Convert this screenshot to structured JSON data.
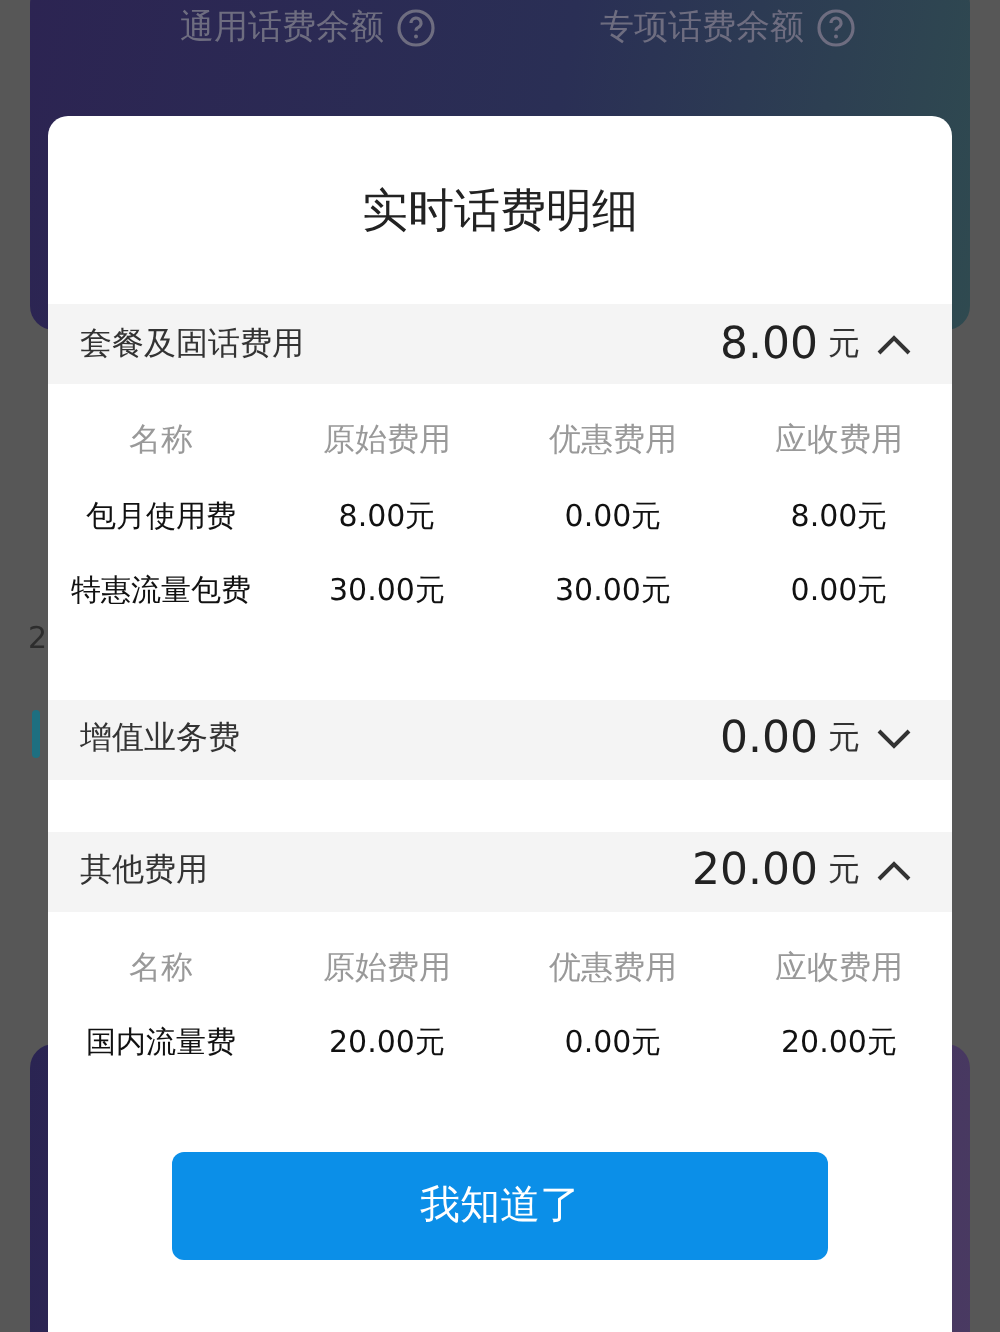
{
  "background": {
    "balances": [
      {
        "label": "通用话费余额"
      },
      {
        "label": "专项话费余额"
      }
    ],
    "side_text": "2"
  },
  "dialog": {
    "title": "实时话费明细",
    "sections": [
      {
        "name": "套餐及固话费用",
        "total": "8.00",
        "unit": "元",
        "expanded": true,
        "columns": [
          "名称",
          "原始费用",
          "优惠费用",
          "应收费用"
        ],
        "rows": [
          [
            "包月使用费",
            "8.00元",
            "0.00元",
            "8.00元"
          ],
          [
            "特惠流量包费",
            "30.00元",
            "30.00元",
            "0.00元"
          ]
        ]
      },
      {
        "name": "增值业务费",
        "total": "0.00",
        "unit": "元",
        "expanded": false
      },
      {
        "name": "其他费用",
        "total": "20.00",
        "unit": "元",
        "expanded": true,
        "columns": [
          "名称",
          "原始费用",
          "优惠费用",
          "应收费用"
        ],
        "rows": [
          [
            "国内流量费",
            "20.00元",
            "0.00元",
            "20.00元"
          ]
        ]
      }
    ],
    "button": "我知道了"
  }
}
